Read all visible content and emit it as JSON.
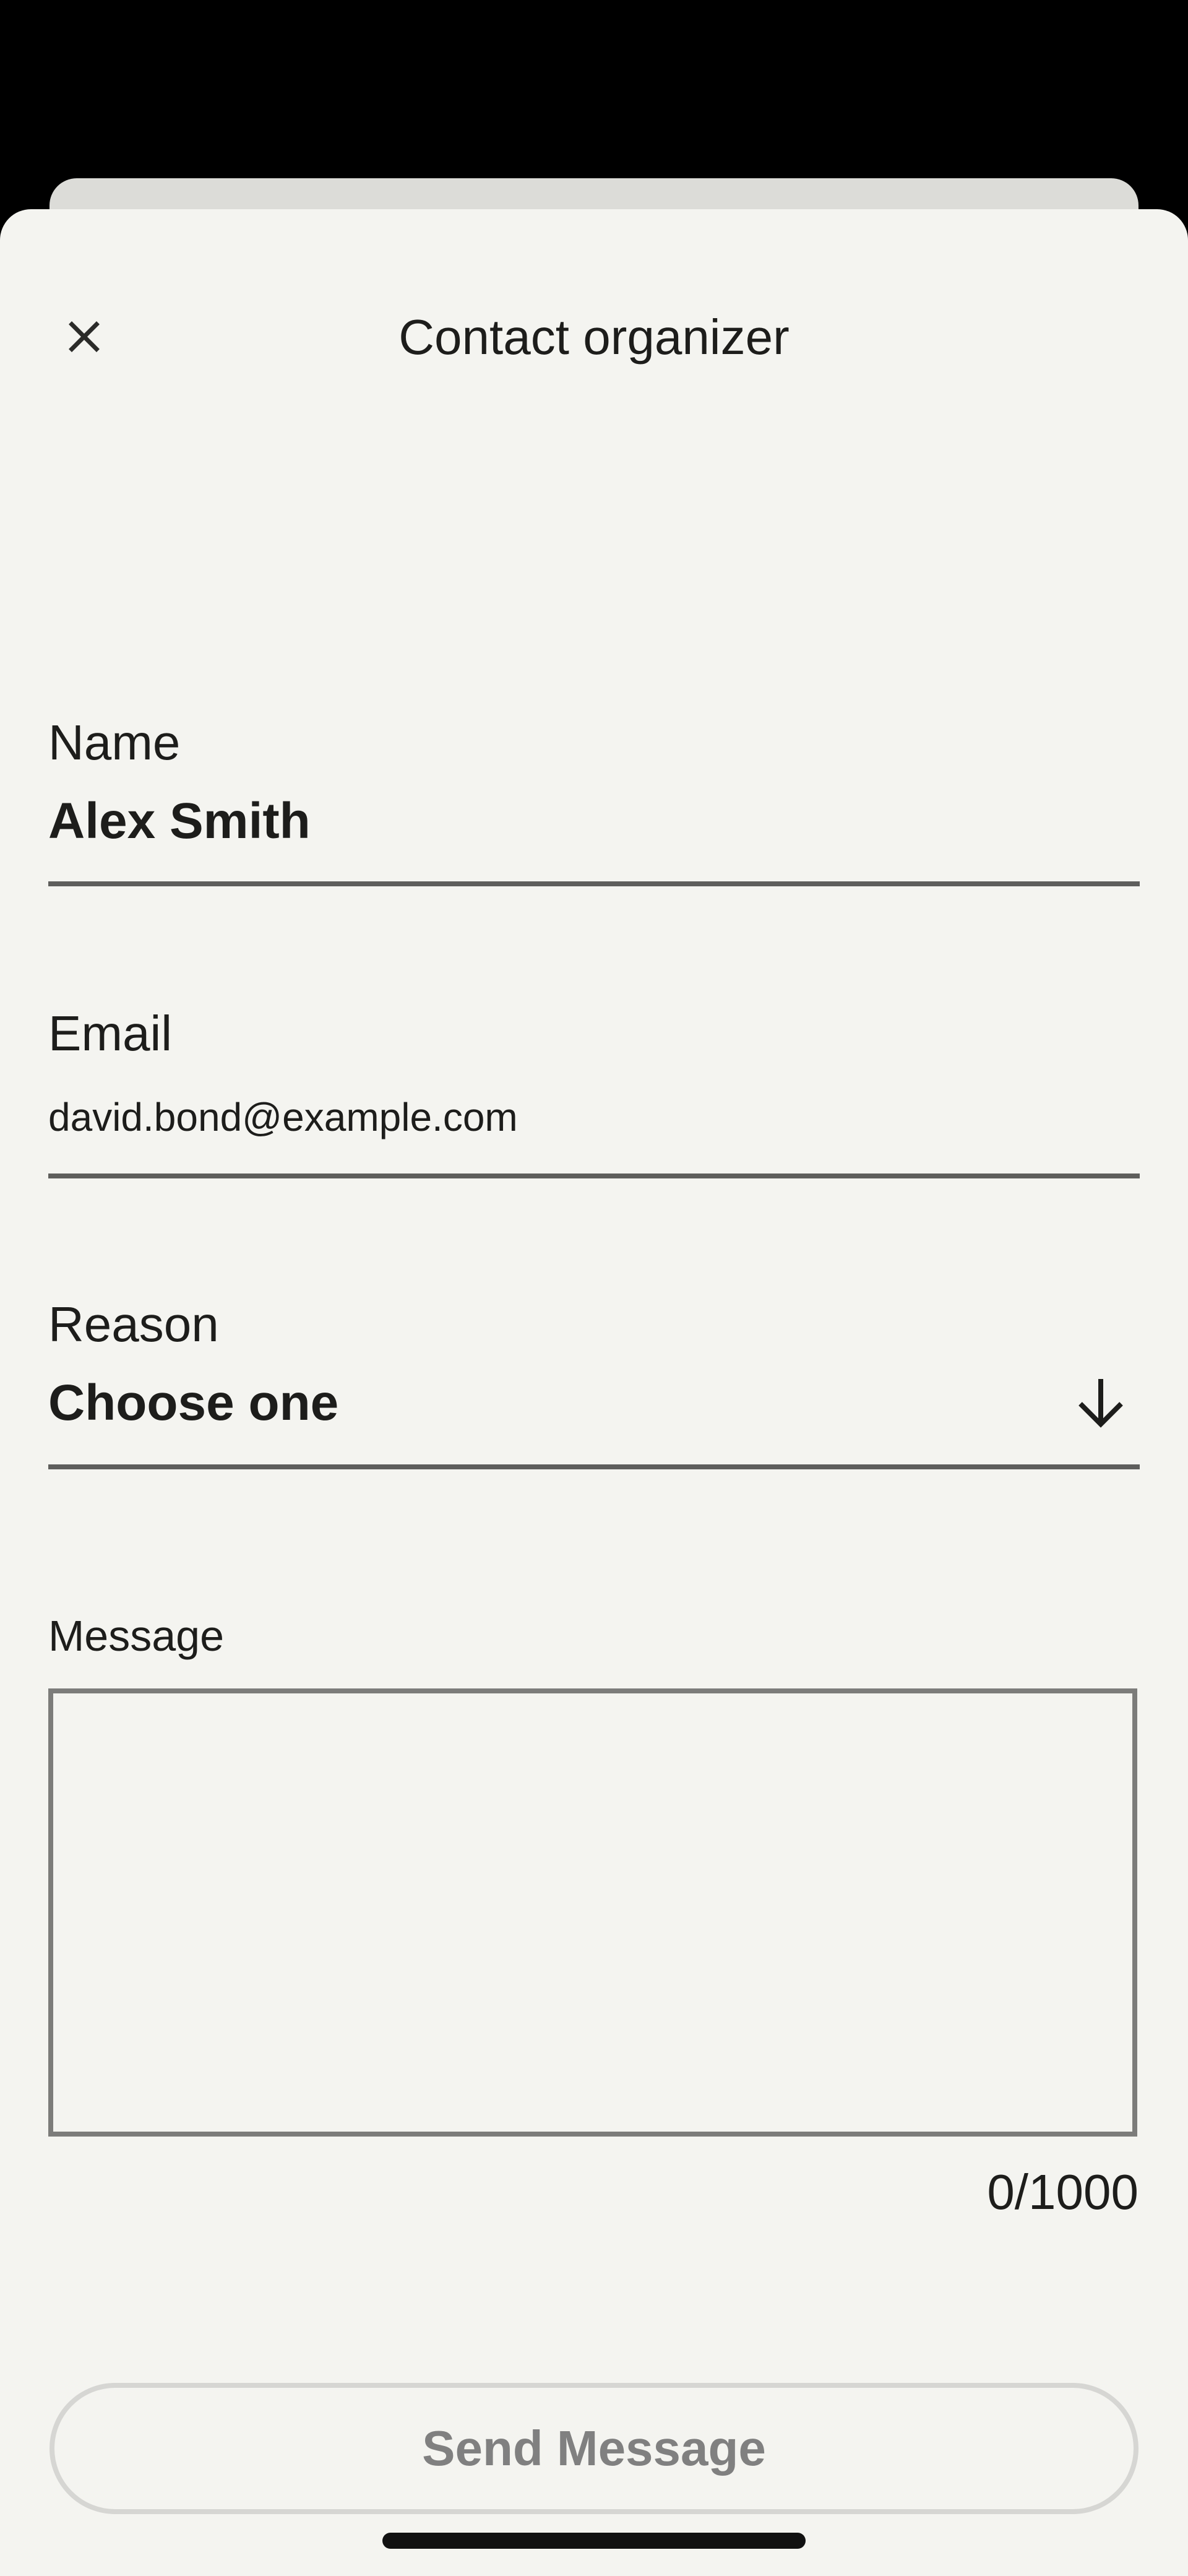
{
  "header": {
    "title": "Contact organizer",
    "close_icon": "close-icon"
  },
  "form": {
    "name": {
      "label": "Name",
      "value": "Alex Smith"
    },
    "email": {
      "label": "Email",
      "value": "david.bond@example.com"
    },
    "reason": {
      "label": "Reason",
      "value": "Choose one",
      "icon": "arrow-down-icon"
    },
    "message": {
      "label": "Message",
      "value": "",
      "counter": "0/1000"
    }
  },
  "actions": {
    "send_label": "Send Message"
  },
  "colors": {
    "background": "#f4f4f0",
    "text": "#1d1d1b",
    "underline": "#5e5e5c",
    "disabled_text": "#808080",
    "disabled_border": "#d6d6d3"
  }
}
